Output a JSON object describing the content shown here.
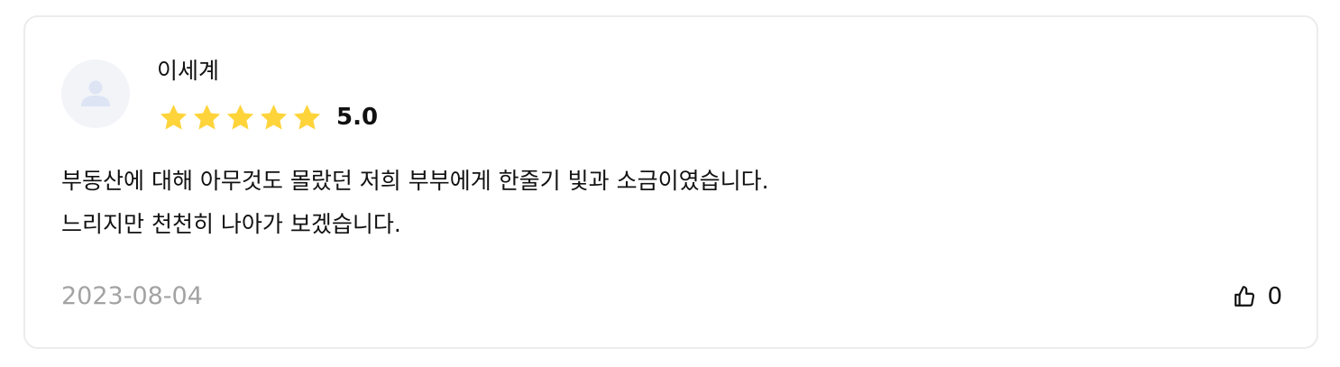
{
  "review": {
    "author": "이세계",
    "rating": 5,
    "rating_max": 5,
    "rating_label": "5.0",
    "text_lines": [
      "부동산에 대해 아무것도 몰랐던 저희 부부에게 한줄기 빛과 소금이였습니다.",
      "느리지만 천천히 나아가 보겠습니다."
    ],
    "date": "2023-08-04",
    "like_count": "0"
  },
  "icons": {
    "avatar": "user-avatar-icon",
    "star": "star-icon",
    "like": "thumbs-up-icon"
  },
  "colors": {
    "star": "#FFD43B",
    "avatar_bg": "#F2F4F8",
    "avatar_fg": "#DDE4F4",
    "date": "#A3A3A3",
    "border": "#ECECEC"
  }
}
